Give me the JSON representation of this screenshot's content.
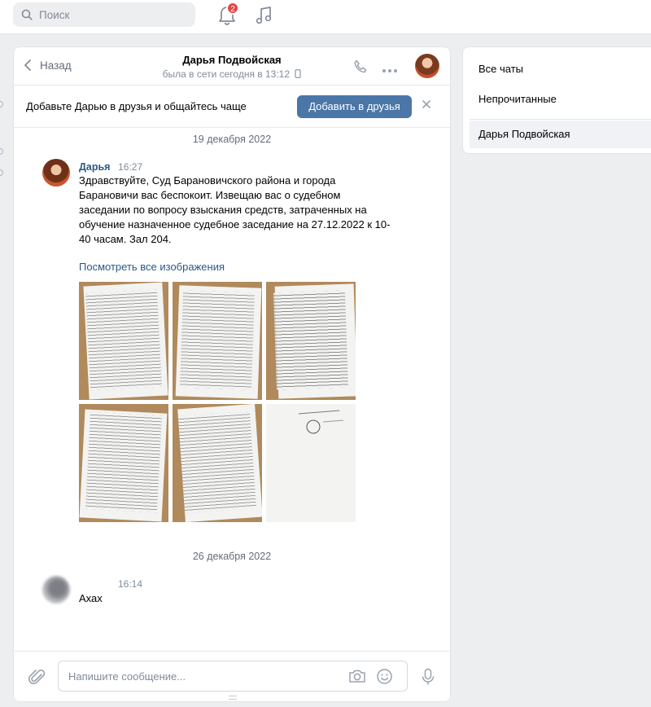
{
  "topbar": {
    "search_placeholder": "Поиск",
    "notifications_count": "2"
  },
  "chat": {
    "back_label": "Назад",
    "peer_name": "Дарья Подвойская",
    "peer_status": "была в сети сегодня в 13:12",
    "friend_prompt": "Добавьте Дарью в друзья и общайтесь чаще",
    "friend_button": "Добавить в друзья",
    "messages": [
      {
        "date": "19 декабря 2022",
        "author": "Дарья",
        "time": "16:27",
        "text": "Здравствуйте, Суд Барановичского района и города Барановичи вас беспокоит. Извещаю вас о судебном заседании по вопросу взыскания средств, затраченных на обучение назначенное судебное заседание на 27.12.2022 к 10-40 часам. Зал 204.",
        "view_all_label": "Посмотреть все изображения",
        "photo_count": 6
      },
      {
        "date": "26 декабря 2022",
        "author": "",
        "time": "16:14",
        "text": "Ахах"
      }
    ],
    "composer_placeholder": "Напишите сообщение..."
  },
  "filters": {
    "items": [
      {
        "label": "Все чаты",
        "active": false
      },
      {
        "label": "Непрочитанные",
        "active": false
      },
      {
        "label": "Дарья Подвойская",
        "active": true
      }
    ]
  },
  "colors": {
    "accent": "#4a76a8",
    "link": "#2a5885",
    "badge": "#e64646",
    "background": "#edeef0"
  }
}
